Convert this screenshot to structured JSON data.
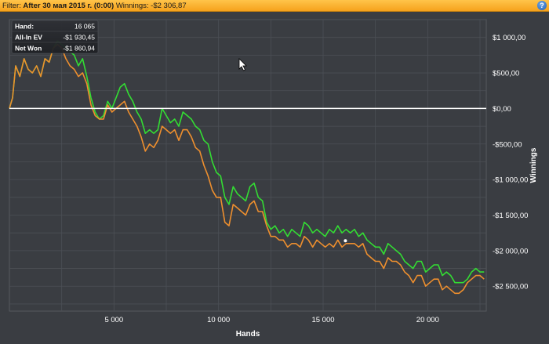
{
  "filter_bar": {
    "filter_label": "Filter:",
    "filter_value": "After 30 мая 2015 г. (0:00)",
    "winnings_label": "Winnings:",
    "winnings_value": "-$2 306,87",
    "help_icon": "question-icon"
  },
  "chart_data": {
    "type": "line",
    "xlabel": "Hands",
    "ylabel": "Winnings",
    "xlim": [
      0,
      22800
    ],
    "ylim": [
      -2850,
      1250
    ],
    "x_ticks": [
      5000,
      10000,
      15000,
      20000
    ],
    "x_tick_labels": [
      "5 000",
      "10 000",
      "15 000",
      "20 000"
    ],
    "y_ticks": [
      1000,
      500,
      0,
      -500,
      -1000,
      -1500,
      -2000,
      -2500
    ],
    "y_tick_labels": [
      "$1 000,00",
      "$500,00",
      "$0,00",
      "-$500,00",
      "-$1 000,00",
      "-$1 500,00",
      "-$2 000,00",
      "-$2 500,00"
    ],
    "grid": true,
    "zero_line": true,
    "colors": {
      "all_in_ev": "#33dd33",
      "net_won": "#ee8f2e",
      "zero_line": "#ffffff",
      "background": "#3a3d42",
      "grid": "#4c5056"
    },
    "tooltip": {
      "rows": [
        {
          "label": "Hand:",
          "value": "16 065"
        },
        {
          "label": "All-In EV",
          "value": "-$1 930,45"
        },
        {
          "label": "Net Won",
          "value": "-$1 860,94"
        }
      ]
    },
    "series": [
      {
        "name": "All-In EV",
        "x": [
          0,
          150,
          300,
          500,
          700,
          900,
          1100,
          1300,
          1500,
          1700,
          1900,
          2100,
          2300,
          2500,
          2700,
          2900,
          3100,
          3300,
          3500,
          3700,
          3900,
          4100,
          4300,
          4500,
          4700,
          4900,
          5100,
          5300,
          5500,
          5700,
          5900,
          6100,
          6300,
          6500,
          6700,
          6900,
          7100,
          7300,
          7500,
          7700,
          7900,
          8100,
          8300,
          8500,
          8700,
          8900,
          9100,
          9300,
          9500,
          9700,
          9900,
          10100,
          10300,
          10500,
          10700,
          10900,
          11100,
          11300,
          11500,
          11700,
          11900,
          12100,
          12300,
          12500,
          12700,
          12900,
          13100,
          13300,
          13500,
          13700,
          13900,
          14100,
          14300,
          14500,
          14700,
          14900,
          15100,
          15300,
          15500,
          15700,
          15900,
          16100,
          16300,
          16500,
          16700,
          16900,
          17100,
          17300,
          17500,
          17700,
          17900,
          18100,
          18300,
          18500,
          18700,
          18900,
          19100,
          19300,
          19500,
          19700,
          19900,
          20100,
          20300,
          20500,
          20700,
          20900,
          21100,
          21300,
          21500,
          21700,
          21900,
          22100,
          22300,
          22500,
          22700
        ],
        "values": [
          0,
          150,
          600,
          450,
          700,
          550,
          500,
          600,
          450,
          700,
          650,
          850,
          950,
          900,
          850,
          800,
          750,
          600,
          700,
          450,
          150,
          -50,
          -150,
          -100,
          100,
          0,
          150,
          300,
          350,
          200,
          100,
          -50,
          -150,
          -350,
          -300,
          -350,
          -300,
          0,
          -100,
          -200,
          -150,
          -250,
          -50,
          -100,
          -150,
          -250,
          -300,
          -450,
          -500,
          -750,
          -900,
          -950,
          -1250,
          -1350,
          -1100,
          -1200,
          -1250,
          -1300,
          -1100,
          -1050,
          -1250,
          -1300,
          -1600,
          -1700,
          -1650,
          -1750,
          -1700,
          -1800,
          -1700,
          -1750,
          -1800,
          -1600,
          -1650,
          -1750,
          -1700,
          -1750,
          -1800,
          -1700,
          -1750,
          -1650,
          -1750,
          -1700,
          -1750,
          -1700,
          -1800,
          -1750,
          -1850,
          -1900,
          -1950,
          -1950,
          -2050,
          -1900,
          -1950,
          -2000,
          -2050,
          -2150,
          -2200,
          -2250,
          -2150,
          -2150,
          -2300,
          -2250,
          -2200,
          -2200,
          -2350,
          -2300,
          -2350,
          -2450,
          -2450,
          -2450,
          -2400,
          -2300,
          -2250,
          -2300,
          -2300
        ]
      },
      {
        "name": "Net Won",
        "x": [
          0,
          150,
          300,
          500,
          700,
          900,
          1100,
          1300,
          1500,
          1700,
          1900,
          2100,
          2300,
          2500,
          2700,
          2900,
          3100,
          3300,
          3500,
          3700,
          3900,
          4100,
          4300,
          4500,
          4700,
          4900,
          5100,
          5300,
          5500,
          5700,
          5900,
          6100,
          6300,
          6500,
          6700,
          6900,
          7100,
          7300,
          7500,
          7700,
          7900,
          8100,
          8300,
          8500,
          8700,
          8900,
          9100,
          9300,
          9500,
          9700,
          9900,
          10100,
          10300,
          10500,
          10700,
          10900,
          11100,
          11300,
          11500,
          11700,
          11900,
          12100,
          12300,
          12500,
          12700,
          12900,
          13100,
          13300,
          13500,
          13700,
          13900,
          14100,
          14300,
          14500,
          14700,
          14900,
          15100,
          15300,
          15500,
          15700,
          15900,
          16100,
          16300,
          16500,
          16700,
          16900,
          17100,
          17300,
          17500,
          17700,
          17900,
          18100,
          18300,
          18500,
          18700,
          18900,
          19100,
          19300,
          19500,
          19700,
          19900,
          20100,
          20300,
          20500,
          20700,
          20900,
          21100,
          21300,
          21500,
          21700,
          21900,
          22100,
          22300,
          22500,
          22700
        ],
        "values": [
          0,
          150,
          600,
          450,
          700,
          550,
          500,
          600,
          450,
          700,
          650,
          850,
          900,
          850,
          700,
          600,
          550,
          450,
          500,
          350,
          50,
          -100,
          -150,
          -150,
          50,
          -50,
          0,
          50,
          100,
          -50,
          -150,
          -250,
          -400,
          -600,
          -500,
          -550,
          -450,
          -250,
          -300,
          -350,
          -300,
          -450,
          -300,
          -300,
          -400,
          -550,
          -600,
          -800,
          -950,
          -1150,
          -1250,
          -1250,
          -1600,
          -1650,
          -1350,
          -1400,
          -1450,
          -1500,
          -1350,
          -1300,
          -1450,
          -1450,
          -1650,
          -1800,
          -1800,
          -1850,
          -1850,
          -1950,
          -1900,
          -1900,
          -1950,
          -1800,
          -1850,
          -1950,
          -1850,
          -1900,
          -1950,
          -1900,
          -1950,
          -1850,
          -1950,
          -1900,
          -1900,
          -1900,
          -1950,
          -1900,
          -2050,
          -2100,
          -2150,
          -2150,
          -2250,
          -2100,
          -2150,
          -2150,
          -2200,
          -2300,
          -2350,
          -2450,
          -2350,
          -2350,
          -2500,
          -2450,
          -2400,
          -2400,
          -2550,
          -2500,
          -2550,
          -2600,
          -2600,
          -2550,
          -2450,
          -2400,
          -2350,
          -2350,
          -2400
        ]
      }
    ]
  }
}
